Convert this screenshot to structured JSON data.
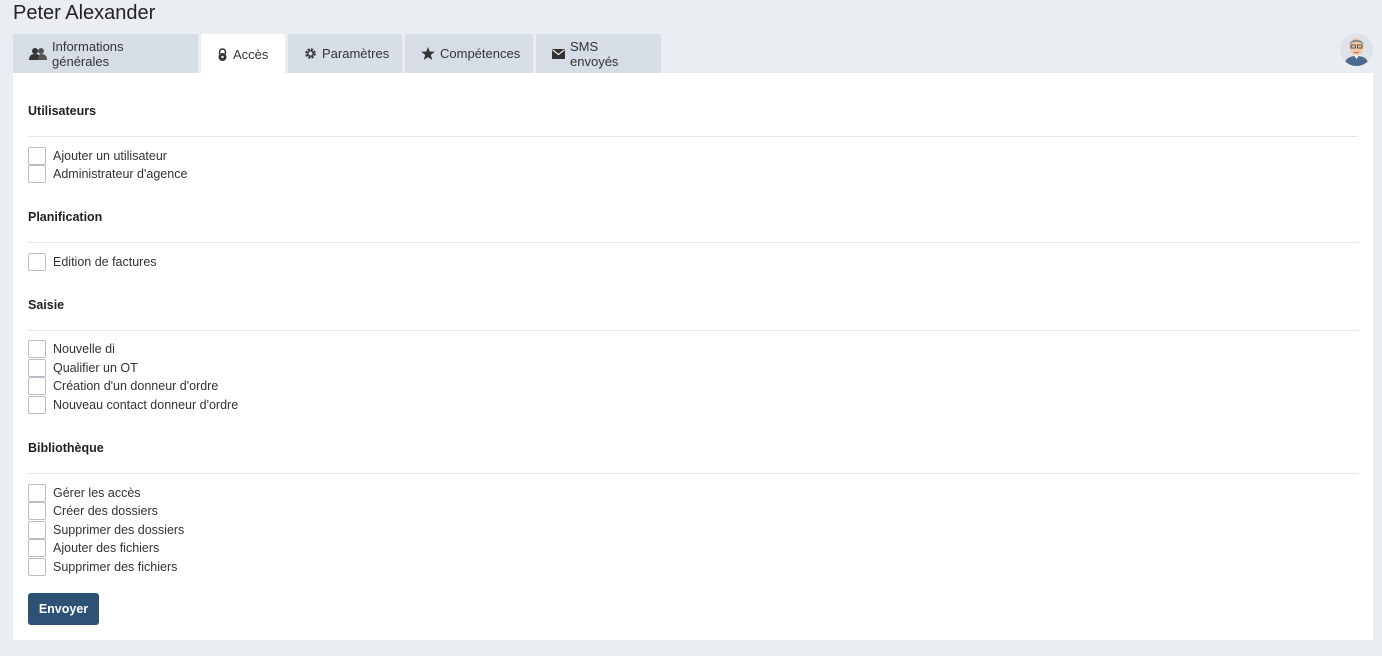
{
  "page_title": "Peter Alexander",
  "tabs": [
    {
      "label": "Informations générales",
      "icon": "users-icon",
      "active": false
    },
    {
      "label": "Accès",
      "icon": "lock-icon",
      "active": true
    },
    {
      "label": "Paramètres",
      "icon": "gear-icon",
      "active": false
    },
    {
      "label": "Compétences",
      "icon": "star-icon",
      "active": false
    },
    {
      "label": "SMS envoyés",
      "icon": "envelope-icon",
      "active": false
    }
  ],
  "sections": [
    {
      "title": "Utilisateurs",
      "items": [
        {
          "label": "Ajouter un utilisateur",
          "checked": false
        },
        {
          "label": "Administrateur d'agence",
          "checked": false
        }
      ]
    },
    {
      "title": "Planification",
      "items": [
        {
          "label": "Edition de factures",
          "checked": false
        }
      ]
    },
    {
      "title": "Saisie",
      "items": [
        {
          "label": "Nouvelle di",
          "checked": false
        },
        {
          "label": "Qualifier un OT",
          "checked": false
        },
        {
          "label": "Création d'un donneur d'ordre",
          "checked": false
        },
        {
          "label": "Nouveau contact donneur d'ordre",
          "checked": false
        }
      ]
    },
    {
      "title": "Bibliothèque",
      "items": [
        {
          "label": "Gérer les accès",
          "checked": false
        },
        {
          "label": "Créer des dossiers",
          "checked": false
        },
        {
          "label": "Supprimer des dossiers",
          "checked": false
        },
        {
          "label": "Ajouter des fichiers",
          "checked": false
        },
        {
          "label": "Supprimer des fichiers",
          "checked": false
        }
      ]
    }
  ],
  "submit_label": "Envoyer",
  "colors": {
    "accent": "#2e5176",
    "background": "#eaedf2",
    "tab_inactive": "#d7dde6"
  }
}
